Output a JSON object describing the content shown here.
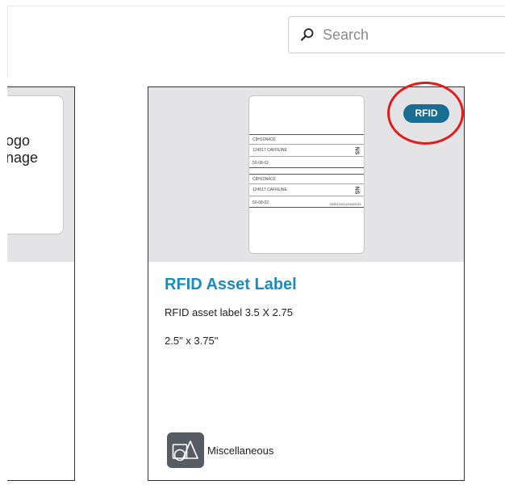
{
  "search": {
    "placeholder": "Search"
  },
  "left_card": {
    "logo_line1": "ogo",
    "logo_line2": "nage"
  },
  "card": {
    "badge": "RFID",
    "title": "RFID Asset Label",
    "description": "RFID asset label 3.5 X 2.75",
    "size": "2.5\" x 3.75\"",
    "category": "Miscellaneous",
    "category_icon": "shapes-icon",
    "preview": {
      "sections": [
        {
          "line1": "C8H10N4O2",
          "line2": "124517 CAFFEINE",
          "line3": "50-08-02",
          "side": "NS"
        },
        {
          "line1": "C8H10N4O2",
          "line2": "124517 CAFFEINE",
          "line3": "50-08-02",
          "side": "NS",
          "code": "782012321123432231"
        }
      ]
    }
  },
  "colors": {
    "accent": "#1a8bbd",
    "badge": "#176e92",
    "highlight": "#e21b1b",
    "image_bg": "#e4e4e6"
  }
}
